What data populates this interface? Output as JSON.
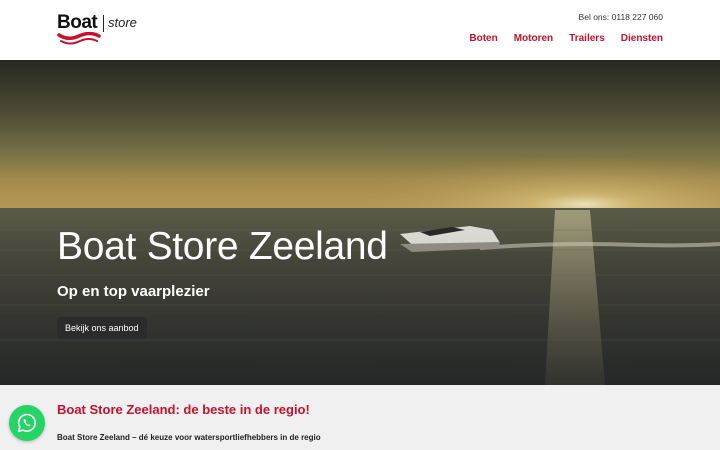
{
  "header": {
    "logo": {
      "brand": "Boat",
      "suffix": "store"
    },
    "phone": "Bel ons: 0118 227 060",
    "nav": [
      {
        "label": "Boten"
      },
      {
        "label": "Motoren"
      },
      {
        "label": "Trailers"
      },
      {
        "label": "Diensten"
      }
    ]
  },
  "hero": {
    "title": "Boat Store Zeeland",
    "subtitle": "Op en top vaarplezier",
    "button": "Bekijk ons aanbod"
  },
  "content": {
    "heading": "Boat Store Zeeland: de beste in de regio!",
    "text": "Boat Store Zeeland – dé keuze voor watersportliefhebbers in de regio"
  },
  "floating": {
    "icon": "whatsapp-icon"
  },
  "colors": {
    "brand": "#c8102e",
    "whatsapp": "#25d366",
    "dark_button": "#2b2b2b",
    "section_bg": "#f0f0f0"
  }
}
